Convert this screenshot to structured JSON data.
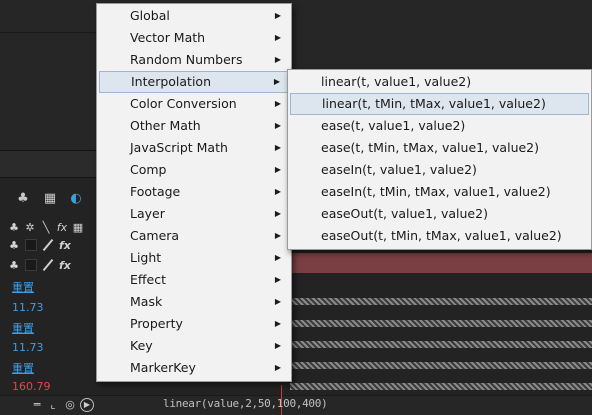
{
  "main_menu": {
    "items": [
      {
        "label": "Global"
      },
      {
        "label": "Vector Math"
      },
      {
        "label": "Random Numbers"
      },
      {
        "label": "Interpolation",
        "selected": true
      },
      {
        "label": "Color Conversion"
      },
      {
        "label": "Other Math"
      },
      {
        "label": "JavaScript Math"
      },
      {
        "label": "Comp"
      },
      {
        "label": "Footage"
      },
      {
        "label": "Layer"
      },
      {
        "label": "Camera"
      },
      {
        "label": "Light"
      },
      {
        "label": "Effect"
      },
      {
        "label": "Mask"
      },
      {
        "label": "Property"
      },
      {
        "label": "Key"
      },
      {
        "label": "MarkerKey"
      }
    ],
    "arrow_glyph": "▶"
  },
  "sub_menu": {
    "items": [
      {
        "label": "linear(t, value1, value2)"
      },
      {
        "label": "linear(t, tMin, tMax, value1, value2)",
        "hover": true
      },
      {
        "label": "ease(t, value1, value2)"
      },
      {
        "label": "ease(t, tMin, tMax, value1, value2)"
      },
      {
        "label": "easeIn(t, value1, value2)"
      },
      {
        "label": "easeIn(t, tMin, tMax, value1, value2)"
      },
      {
        "label": "easeOut(t, value1, value2)"
      },
      {
        "label": "easeOut(t, tMin, tMax, value1, value2)"
      }
    ]
  },
  "properties": [
    {
      "text": "重置",
      "kind": "link"
    },
    {
      "text": "11.73",
      "kind": "number"
    },
    {
      "text": "重置",
      "kind": "link"
    },
    {
      "text": "11.73",
      "kind": "number"
    },
    {
      "text": "重置",
      "kind": "link"
    },
    {
      "text": "160.79",
      "kind": "number-red"
    }
  ],
  "expression": "linear(value,2,50,100,400)",
  "colors": {
    "menu_bg": "#f2f2f2",
    "menu_highlight": "#dde5ef",
    "link_blue": "#3d9ee8",
    "value_red": "#e04848",
    "layer_bar": "#7a3f43"
  }
}
